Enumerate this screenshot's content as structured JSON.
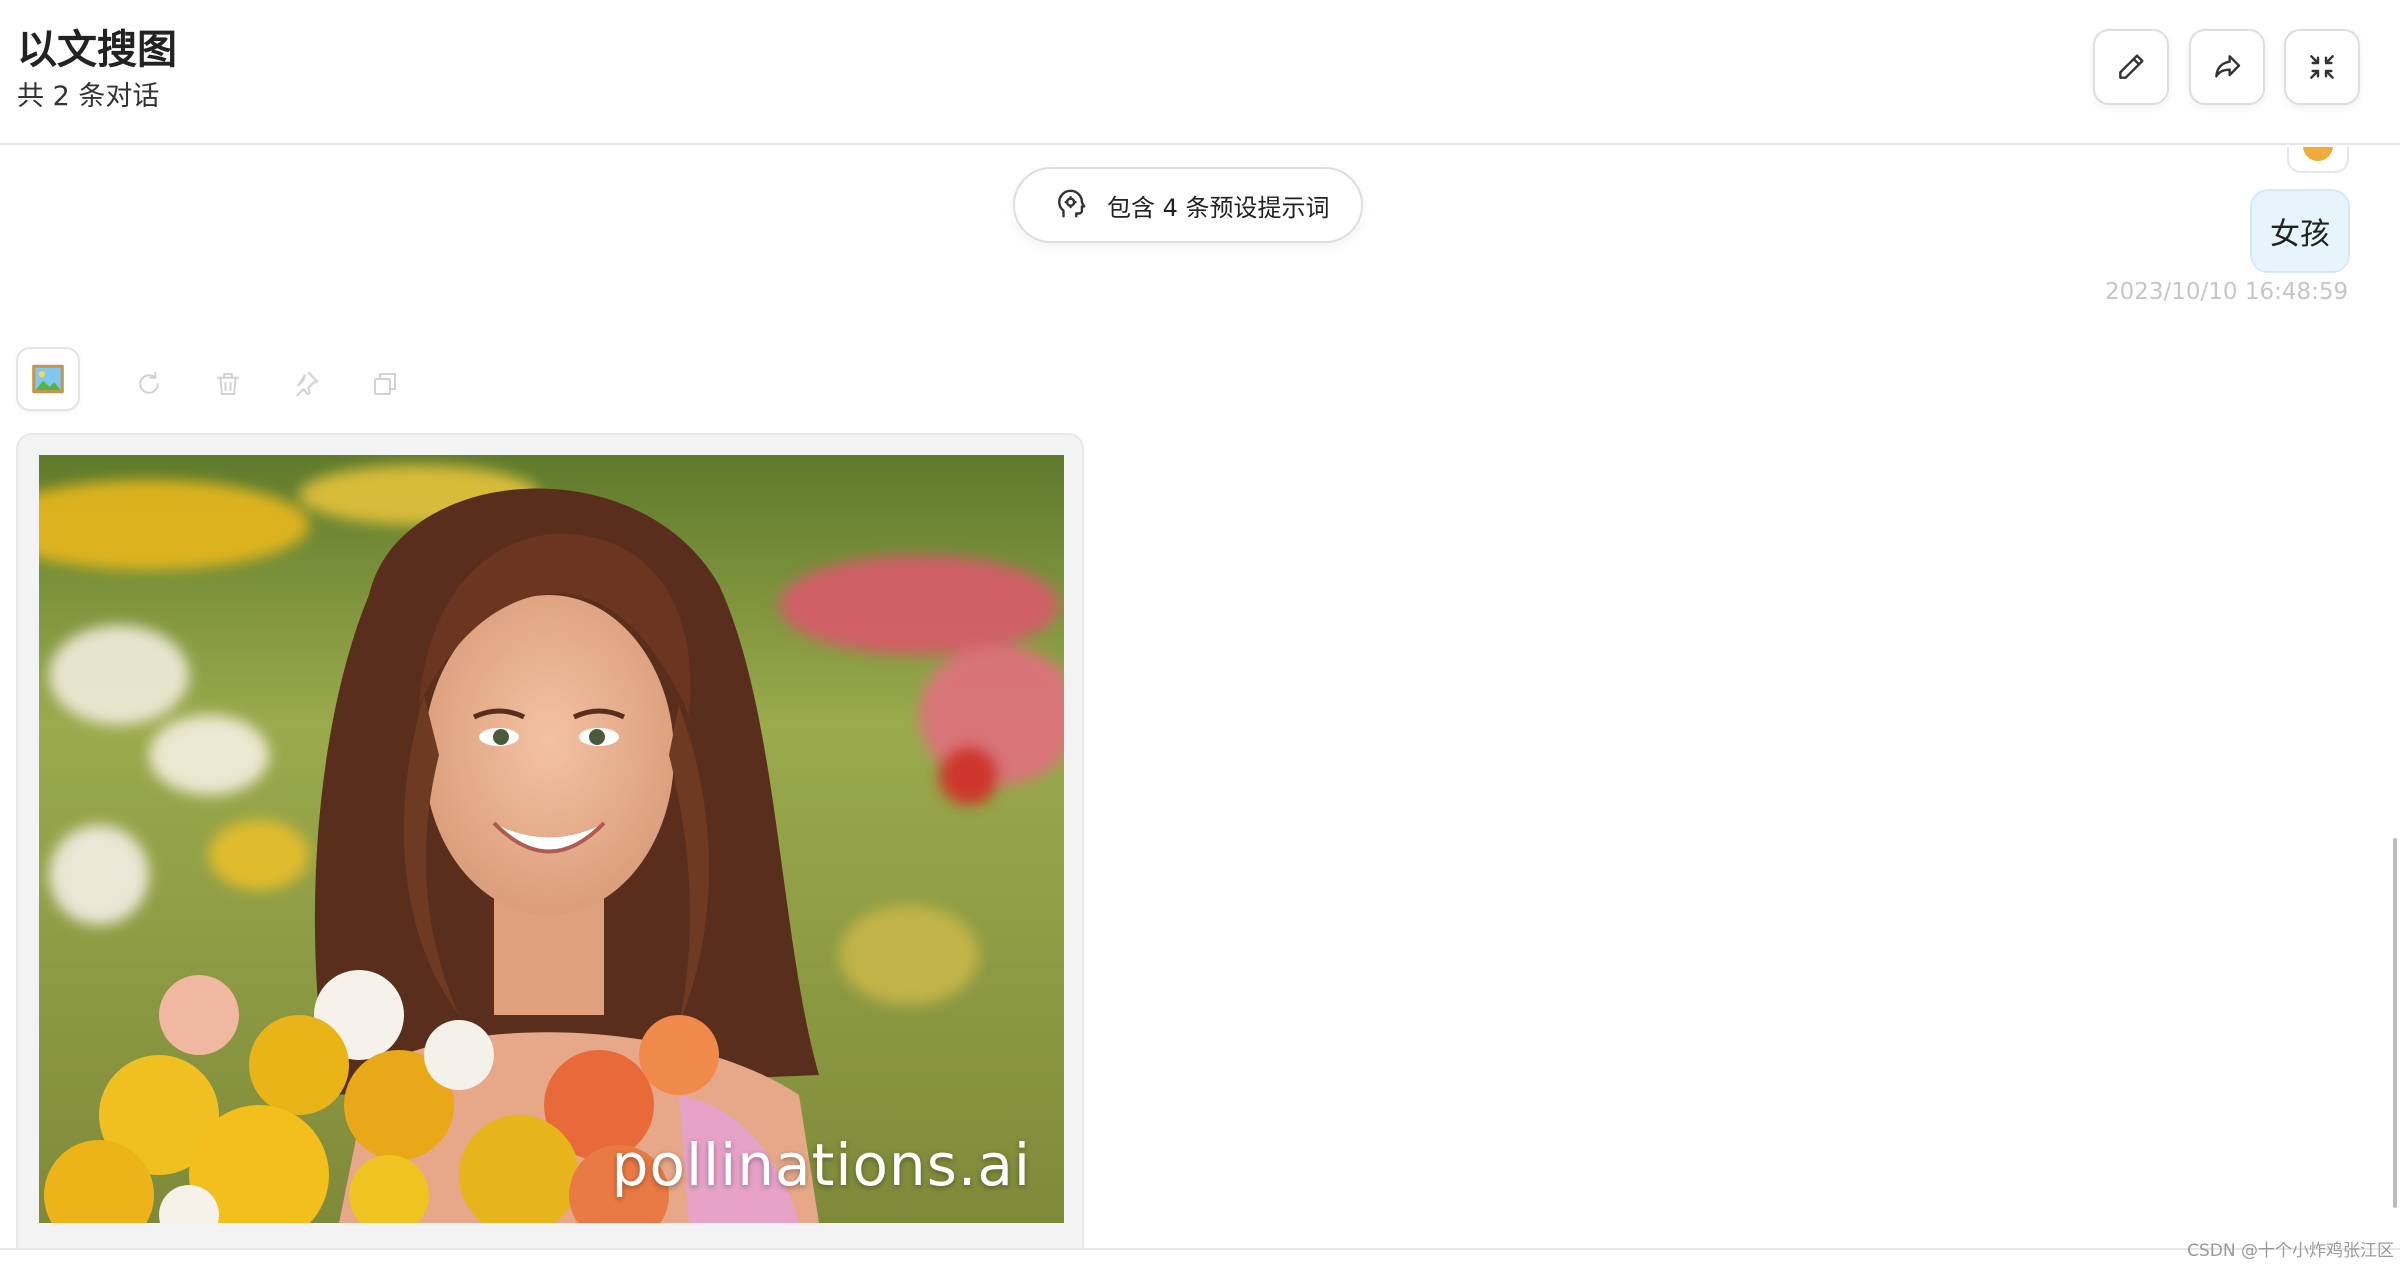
{
  "header": {
    "title": "以文搜图",
    "subtitle": "共 2 条对话",
    "buttons": [
      {
        "name": "edit",
        "icon": "pencil-icon"
      },
      {
        "name": "share",
        "icon": "share-arrow-icon"
      },
      {
        "name": "collapse",
        "icon": "collapse-arrows-icon"
      }
    ]
  },
  "chat": {
    "prompt_pill": {
      "label": "包含 4 条预设提示词",
      "icon": "brain-head-icon"
    },
    "user_message": {
      "text": "女孩",
      "timestamp": "2023/10/10 16:48:59"
    },
    "bot_message": {
      "avatar_icon": "picture-frame-icon",
      "actions": [
        "refresh-icon",
        "delete-icon",
        "pin-icon",
        "copy-icon"
      ],
      "image": {
        "description_icon": "generated-photo",
        "watermark": "pollinations.ai"
      }
    }
  },
  "footer": {
    "credit": "CSDN @十个小炸鸡张江区"
  },
  "colors": {
    "accent_bubble": "#e6f4fc",
    "timestamp": "#c6c6c6",
    "border": "#dedede"
  }
}
